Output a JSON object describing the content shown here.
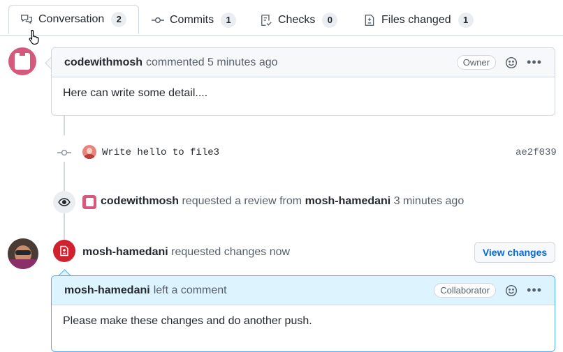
{
  "tabs": [
    {
      "label": "Conversation",
      "count": "2",
      "icon": "comment-discussion-icon"
    },
    {
      "label": "Commits",
      "count": "1",
      "icon": "git-commit-icon"
    },
    {
      "label": "Checks",
      "count": "0",
      "icon": "checklist-icon"
    },
    {
      "label": "Files changed",
      "count": "1",
      "icon": "file-diff-icon"
    }
  ],
  "comment1": {
    "author": "codewithmosh",
    "meta": "commented 5 minutes ago",
    "role": "Owner",
    "body": "Here can write some detail...."
  },
  "commit": {
    "message": "Write hello to file3",
    "sha": "ae2f039"
  },
  "review_request": {
    "actor": "codewithmosh",
    "text": "requested a review from",
    "target": "mosh-hamedani",
    "time": "3 minutes ago"
  },
  "changes_request": {
    "actor": "mosh-hamedani",
    "text": "requested changes now",
    "button": "View changes"
  },
  "comment2": {
    "author": "mosh-hamedani",
    "meta": "left a comment",
    "role": "Collaborator",
    "body": "Please make these changes and do another push."
  },
  "colors": {
    "accent": "#0969da",
    "danger": "#cf222e",
    "border": "#d0d7de"
  }
}
